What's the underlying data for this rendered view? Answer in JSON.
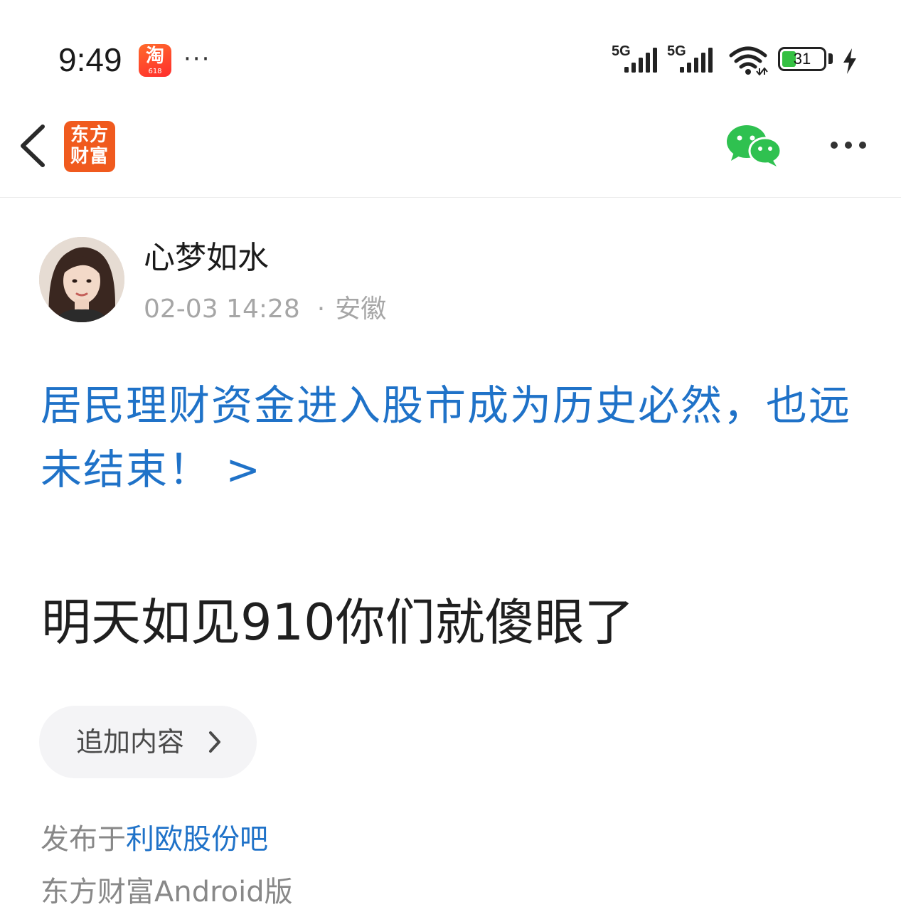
{
  "status_bar": {
    "time": "9:49",
    "taobao_icon_text": "淘",
    "taobao_icon_sub": "618",
    "more": "···",
    "signal_1_label": "5G",
    "signal_2_label": "5G",
    "battery_level": "31",
    "battery_color": "#35c043"
  },
  "nav": {
    "back_icon": "chevron-left-icon",
    "logo_line1": "东方",
    "logo_line2": "财富",
    "logo_color": "#f05a1e",
    "share_icon": "wechat-icon",
    "more_icon": "more-horizontal-icon"
  },
  "post": {
    "author": "心梦如水",
    "date": "02-03 14:28",
    "separator": "·",
    "location": "安徽",
    "linked_title": "居民理财资金进入股市成为历史必然，也远未结束！ >",
    "body": "明天如见910你们就傻眼了",
    "append_label": "追加内容",
    "published_prefix": "发布于",
    "published_bar": "利欧股份吧",
    "client": "东方财富Android版",
    "link_color": "#1f72c8"
  }
}
